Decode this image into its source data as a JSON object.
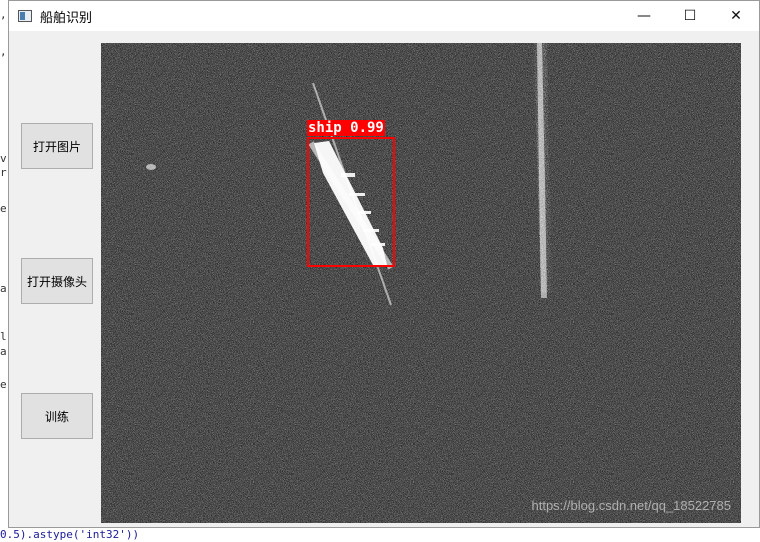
{
  "window": {
    "title": "船舶识别",
    "minimize_glyph": "—",
    "maximize_glyph": "☐",
    "close_glyph": "✕"
  },
  "buttons": {
    "open_image": "打开图片",
    "open_camera": "打开摄像头",
    "train": "训练"
  },
  "detection": {
    "label": "ship 0.99",
    "color": "#ff0000"
  },
  "watermark": "https://blog.csdn.net/qq_18522785",
  "background_code": {
    "line": "0.5).astype('int32'))"
  }
}
